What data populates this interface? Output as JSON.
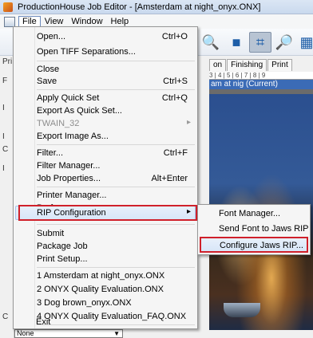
{
  "window": {
    "title": "ProductionHouse Job Editor - [Amsterdam at night_onyx.ONX]"
  },
  "menubar": {
    "items": [
      "File",
      "View",
      "Window",
      "Help"
    ]
  },
  "tabs": [
    "on",
    "Finishing",
    "Print"
  ],
  "ruler_text": "3 | 4 | 5 | 6 | 7 | 8 | 9",
  "doc_title": "am at nig (Current)",
  "left_panel_letters": [
    "Pri",
    "F",
    "I",
    "I",
    "C",
    "I",
    "C"
  ],
  "bottom_select": {
    "value": "None"
  },
  "file_menu": {
    "items": [
      {
        "label": "Open...",
        "shortcut": "Ctrl+O"
      },
      {
        "label": "Open TIFF Separations...",
        "shortcut": ""
      },
      {
        "label": "Close",
        "shortcut": ""
      },
      {
        "label": "Save",
        "shortcut": "Ctrl+S"
      },
      {
        "label": "Apply Quick Set",
        "shortcut": "Ctrl+Q"
      },
      {
        "label": "Export As Quick Set...",
        "shortcut": ""
      },
      {
        "label": "TWAIN_32",
        "shortcut": ""
      },
      {
        "label": "Export Image As...",
        "shortcut": ""
      },
      {
        "label": "Filter...",
        "shortcut": "Ctrl+F"
      },
      {
        "label": "Filter Manager...",
        "shortcut": ""
      },
      {
        "label": "Job Properties...",
        "shortcut": "Alt+Enter"
      },
      {
        "label": "Printer Manager...",
        "shortcut": ""
      },
      {
        "label": "Preferences...",
        "shortcut": ""
      },
      {
        "label": "RIP Configuration",
        "shortcut": ""
      },
      {
        "label": "Submit",
        "shortcut": ""
      },
      {
        "label": "Package Job",
        "shortcut": ""
      },
      {
        "label": "Print Setup...",
        "shortcut": ""
      },
      {
        "label": "1 Amsterdam at night_onyx.ONX",
        "shortcut": ""
      },
      {
        "label": "2 ONYX Quality Evaluation.ONX",
        "shortcut": ""
      },
      {
        "label": "3 Dog brown_onyx.ONX",
        "shortcut": ""
      },
      {
        "label": "4 ONYX Quality Evaluation_FAQ.ONX",
        "shortcut": ""
      },
      {
        "label": "Exit",
        "shortcut": ""
      }
    ]
  },
  "rip_submenu": {
    "items": [
      "Font Manager...",
      "Send Font to Jaws RIP",
      "Configure Jaws RIP..."
    ]
  },
  "colors": {
    "highlight": "#d8e6f8",
    "annotation_red": "#d0202a",
    "accent_blue": "#3b6bb6"
  }
}
